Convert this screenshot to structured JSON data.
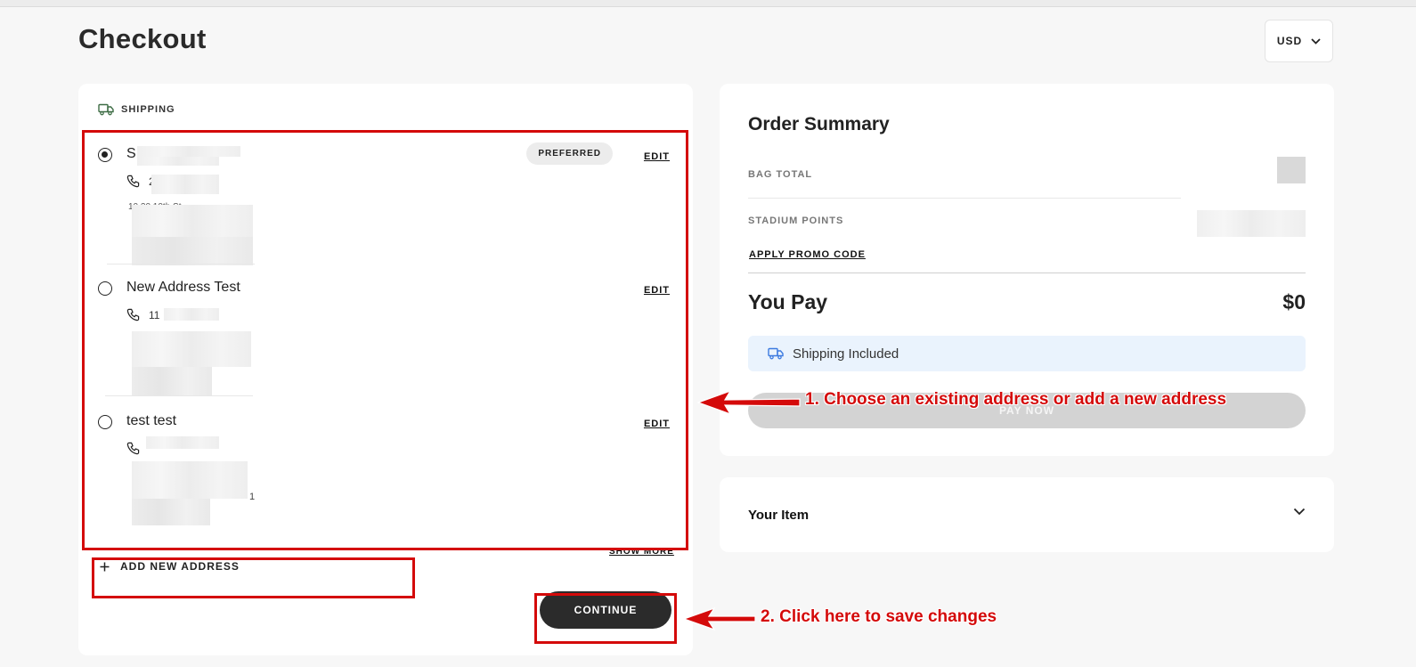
{
  "page": {
    "title": "Checkout"
  },
  "currency": {
    "label": "USD"
  },
  "shipping": {
    "section_label": "SHIPPING",
    "addresses": [
      {
        "name": "S",
        "phone": "2",
        "address_line": "10 20 10th St",
        "preferred_label": "PREFERRED",
        "edit_label": "EDIT",
        "selected": true
      },
      {
        "name": "New Address Test",
        "phone": "11",
        "edit_label": "EDIT",
        "selected": false
      },
      {
        "name": "test test",
        "phone": "",
        "address_tail": "1",
        "edit_label": "EDIT",
        "selected": false
      }
    ],
    "show_more_label": "SHOW MORE",
    "add_address_label": "ADD NEW ADDRESS",
    "continue_label": "CONTINUE"
  },
  "summary": {
    "title": "Order Summary",
    "bag_total_label": "BAG TOTAL",
    "stadium_points_label": "STADIUM POINTS",
    "promo_label": "APPLY PROMO CODE",
    "you_pay_label": "You Pay",
    "you_pay_amount": "$0",
    "shipping_included_label": "Shipping Included",
    "pay_now_label": "PAY NOW"
  },
  "item": {
    "title": "Your Item"
  },
  "annotations": {
    "step1": "1. Choose an existing address or add a new address",
    "step2": "2. Click here to save changes",
    "color": "#d40a0a"
  },
  "colors": {
    "accent_dark": "#2b2b2b",
    "shipping_icon": "#3e6d45",
    "info_bg": "#eaf3fd",
    "info_icon": "#3d7be0"
  }
}
